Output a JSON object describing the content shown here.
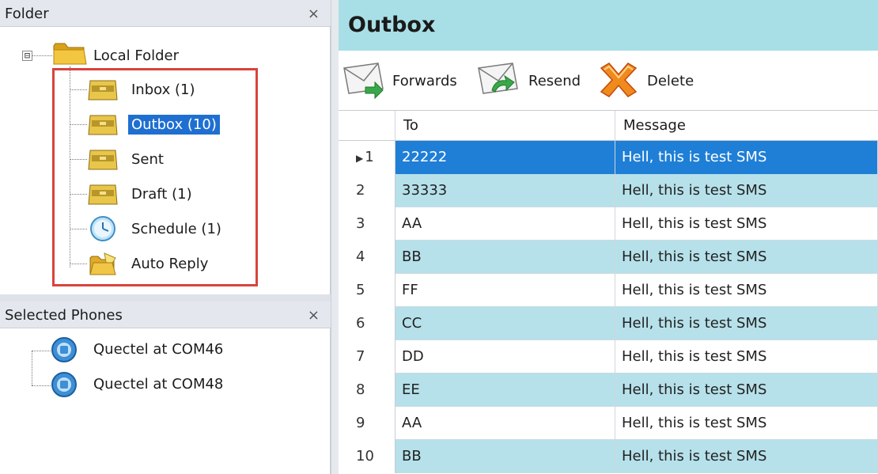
{
  "folder_pane": {
    "title": "Folder",
    "close_glyph": "×",
    "root": {
      "expander": "⊟",
      "label": "Local Folder",
      "icon": "folder-icon"
    },
    "items": [
      {
        "label": "Inbox (1)",
        "icon": "inbox-tray-icon",
        "selected": false
      },
      {
        "label": "Outbox (10)",
        "icon": "outbox-tray-icon",
        "selected": true
      },
      {
        "label": "Sent",
        "icon": "sent-tray-icon",
        "selected": false
      },
      {
        "label": "Draft (1)",
        "icon": "draft-tray-icon",
        "selected": false
      },
      {
        "label": "Schedule (1)",
        "icon": "clock-icon",
        "selected": false
      },
      {
        "label": "Auto Reply",
        "icon": "auto-reply-icon",
        "selected": false
      }
    ]
  },
  "phones_pane": {
    "title": "Selected Phones",
    "close_glyph": "×",
    "phones": [
      {
        "label": "Quectel at COM46",
        "icon": "modem-icon"
      },
      {
        "label": "Quectel at COM48",
        "icon": "modem-icon"
      }
    ]
  },
  "main": {
    "title": "Outbox",
    "toolbar": {
      "forwards": "Forwards",
      "resend": "Resend",
      "delete": "Delete"
    },
    "columns": {
      "number": "",
      "to": "To",
      "message": "Message"
    },
    "row_marker": "▶",
    "rows": [
      {
        "num": "1",
        "to": "22222",
        "message": "Hell, this is test SMS",
        "selected": true
      },
      {
        "num": "2",
        "to": "33333",
        "message": "Hell, this is test SMS"
      },
      {
        "num": "3",
        "to": "AA",
        "message": "Hell, this is test SMS"
      },
      {
        "num": "4",
        "to": "BB",
        "message": "Hell, this is test SMS"
      },
      {
        "num": "5",
        "to": "FF",
        "message": "Hell, this is test SMS"
      },
      {
        "num": "6",
        "to": "CC",
        "message": "Hell, this is test SMS"
      },
      {
        "num": "7",
        "to": "DD",
        "message": "Hell, this is test SMS"
      },
      {
        "num": "8",
        "to": "EE",
        "message": "Hell, this is test SMS"
      },
      {
        "num": "9",
        "to": "AA",
        "message": "Hell, this is test SMS"
      },
      {
        "num": "10",
        "to": "BB",
        "message": "Hell, this is test SMS"
      }
    ]
  },
  "colors": {
    "title_bar": "#a8dfe6",
    "alt_row": "#b6e1ea",
    "selection": "#1f7fd6",
    "highlight_box": "#d9433b"
  }
}
